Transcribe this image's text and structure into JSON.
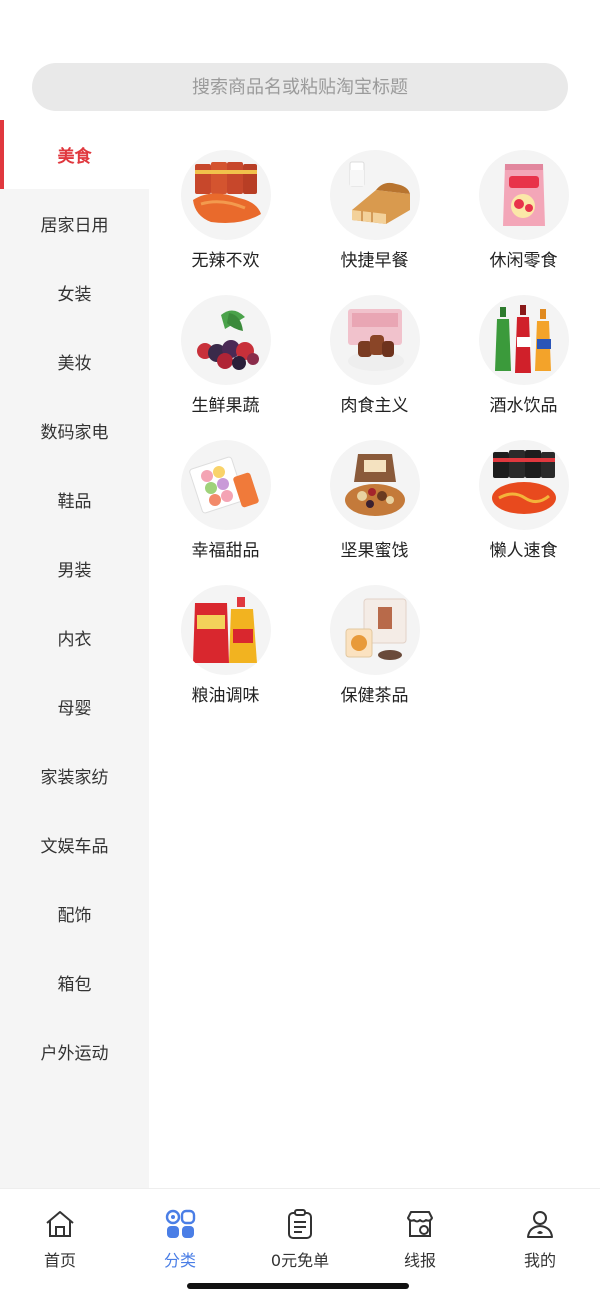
{
  "search": {
    "placeholder": "搜索商品名或粘贴淘宝标题"
  },
  "sidebar": {
    "items": [
      {
        "label": "美食",
        "active": true
      },
      {
        "label": "居家日用"
      },
      {
        "label": "女装"
      },
      {
        "label": "美妆"
      },
      {
        "label": "数码家电"
      },
      {
        "label": "鞋品"
      },
      {
        "label": "男装"
      },
      {
        "label": "内衣"
      },
      {
        "label": "母婴"
      },
      {
        "label": "家装家纺"
      },
      {
        "label": "文娱车品"
      },
      {
        "label": "配饰"
      },
      {
        "label": "箱包"
      },
      {
        "label": "户外运动"
      }
    ]
  },
  "categories": [
    {
      "name": "无辣不欢",
      "icon": "spicy-snack-icon"
    },
    {
      "name": "快捷早餐",
      "icon": "bread-milk-icon"
    },
    {
      "name": "休闲零食",
      "icon": "chips-bag-icon"
    },
    {
      "name": "生鲜果蔬",
      "icon": "berries-icon"
    },
    {
      "name": "肉食主义",
      "icon": "meat-box-icon"
    },
    {
      "name": "酒水饮品",
      "icon": "soda-bottles-icon"
    },
    {
      "name": "幸福甜品",
      "icon": "macaron-box-icon"
    },
    {
      "name": "坚果蜜饯",
      "icon": "nuts-bowl-icon"
    },
    {
      "name": "懒人速食",
      "icon": "instant-noodle-icon"
    },
    {
      "name": "粮油调味",
      "icon": "rice-oil-icon"
    },
    {
      "name": "保健茶品",
      "icon": "tea-box-icon"
    }
  ],
  "tabbar": {
    "tabs": [
      {
        "label": "首页",
        "icon": "home-icon"
      },
      {
        "label": "分类",
        "icon": "category-icon",
        "active": true
      },
      {
        "label": "0元免单",
        "icon": "clipboard-icon"
      },
      {
        "label": "线报",
        "icon": "store-icon"
      },
      {
        "label": "我的",
        "icon": "profile-icon"
      }
    ]
  },
  "colors": {
    "accent_red": "#e0383e",
    "active_blue": "#4a7ee6",
    "sidebar_bg": "#f5f5f5"
  }
}
